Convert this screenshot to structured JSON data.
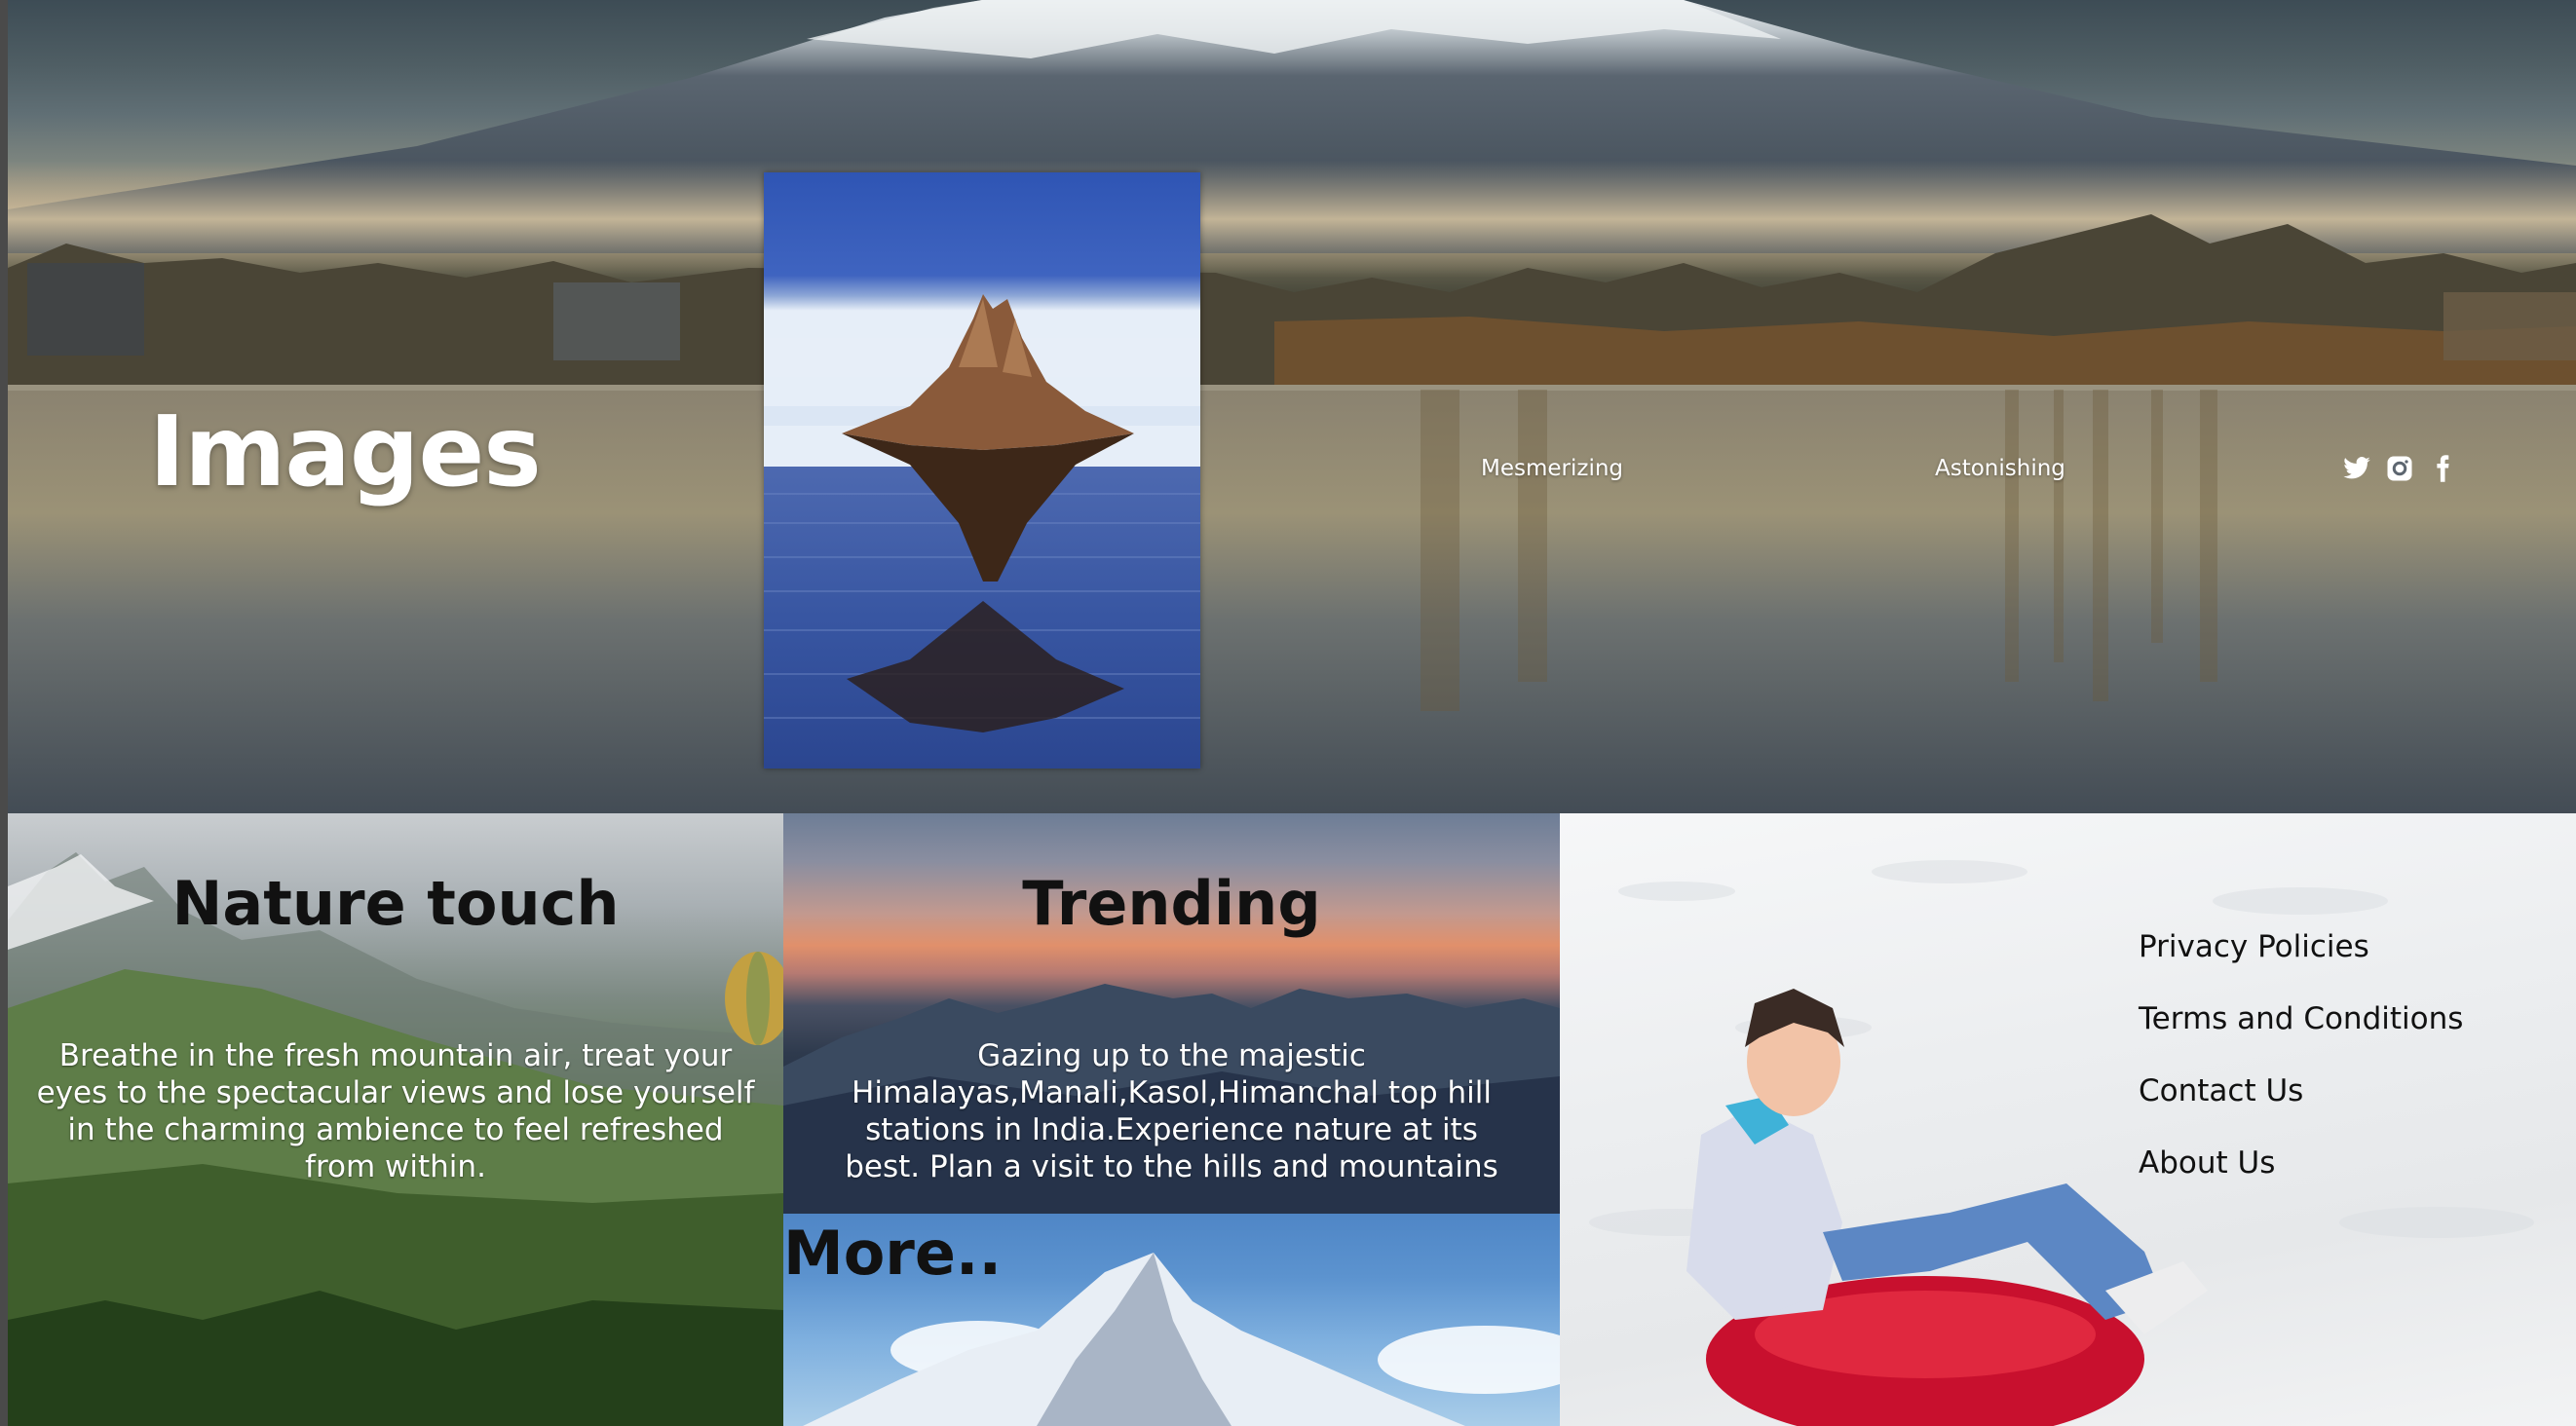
{
  "hero": {
    "title": "Images",
    "nav": [
      {
        "label": "Mesmerizing"
      },
      {
        "label": "Astonishing"
      }
    ],
    "social": [
      {
        "icon": "twitter-icon"
      },
      {
        "icon": "instagram-icon"
      },
      {
        "icon": "facebook-icon"
      }
    ]
  },
  "panels": {
    "nature": {
      "heading": "Nature touch",
      "text": "Breathe in the fresh mountain air, treat your eyes to the spectacular views and lose yourself in the charming ambience to feel refreshed from within."
    },
    "trending": {
      "heading": "Trending",
      "text": "Gazing up to the majestic Himalayas,Manali,Kasol,Himanchal top hill stations in India.Experience nature at its best. Plan a visit to the hills and mountains"
    },
    "more": {
      "heading": "More.."
    },
    "footer": {
      "links": [
        {
          "label": "Privacy Policies"
        },
        {
          "label": "Terms and Conditions"
        },
        {
          "label": "Contact Us"
        },
        {
          "label": "About Us"
        }
      ]
    }
  },
  "colors": {
    "heading_text": "#111111",
    "light_text": "#ffffff"
  }
}
